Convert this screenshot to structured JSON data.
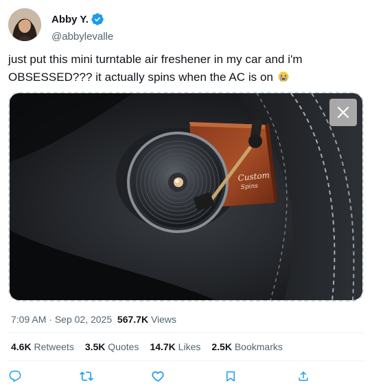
{
  "author": {
    "name": "Abby Y.",
    "handle": "@abbylevalle",
    "verified": true
  },
  "post": {
    "text": "just put this mini turntable air freshener in my car and i'm OBSESSED??? it actually spins when the AC is on",
    "emoji": "crying-face",
    "media": {
      "product_label_line1": "Custom",
      "product_label_line2": "Spins",
      "close_icon": "close-icon"
    }
  },
  "meta": {
    "time": "7:09 AM",
    "separator": " · ",
    "date": "Sep 02, 2025",
    "views_count": "567.7K",
    "views_label": " Views"
  },
  "stats": [
    {
      "count": "4.6K",
      "label": " Retweets"
    },
    {
      "count": "3.5K",
      "label": " Quotes"
    },
    {
      "count": "14.7K",
      "label": " Likes"
    },
    {
      "count": "2.5K",
      "label": " Bookmarks"
    }
  ],
  "actions": [
    "reply-icon",
    "retweet-icon",
    "like-icon",
    "bookmark-icon",
    "share-icon"
  ],
  "colors": {
    "verified": "#1d9bf0",
    "secondary_text": "#536471",
    "icon": "#1d9bf0"
  }
}
